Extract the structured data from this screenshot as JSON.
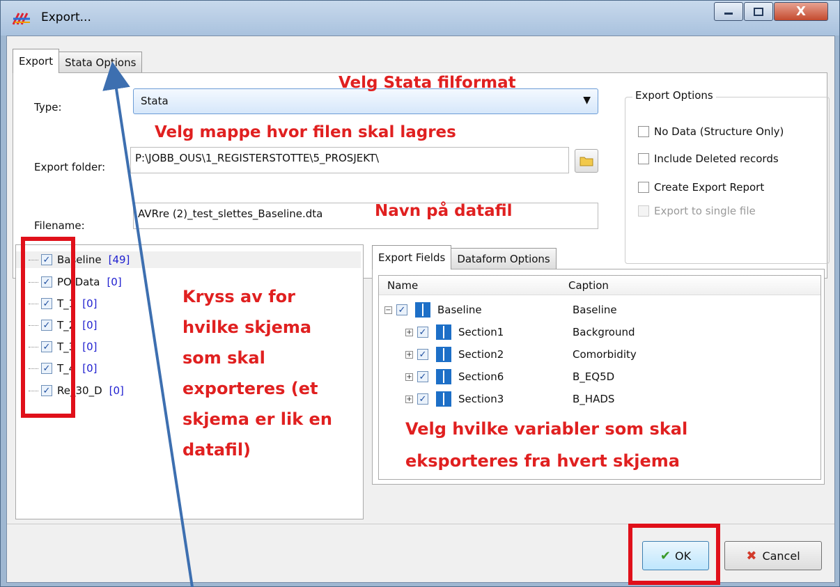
{
  "window": {
    "title": "Export...",
    "close_glyph": "X"
  },
  "tabs": {
    "export": "Export",
    "stata_options": "Stata Options"
  },
  "form": {
    "type_label": "Type:",
    "type_value": "Stata",
    "folder_label": "Export folder:",
    "folder_value": "P:\\JOBB_OUS\\1_REGISTERSTOTTE\\5_PROSJEKT\\",
    "filename_label": "Filename:",
    "filename_value": "AVRre (2)_test_slettes_Baseline.dta"
  },
  "export_options": {
    "title": "Export Options",
    "items": [
      {
        "label": "No Data (Structure Only)",
        "checked": false,
        "enabled": true
      },
      {
        "label": "Include Deleted records",
        "checked": false,
        "enabled": true
      },
      {
        "label": "Create Export Report",
        "checked": false,
        "enabled": true
      },
      {
        "label": "Export to single file",
        "checked": false,
        "enabled": false
      }
    ]
  },
  "dataforms": [
    {
      "name": "Baseline",
      "count": "[49]",
      "checked": true
    },
    {
      "name": "PO Data",
      "count": "[0]",
      "checked": true
    },
    {
      "name": "T_1",
      "count": "[0]",
      "checked": true
    },
    {
      "name": "T_2",
      "count": "[0]",
      "checked": true
    },
    {
      "name": "T_3",
      "count": "[0]",
      "checked": true
    },
    {
      "name": "T_4",
      "count": "[0]",
      "checked": true
    },
    {
      "name": "Re_30_D",
      "count": "[0]",
      "checked": true
    }
  ],
  "inner_tabs": {
    "export_fields": "Export Fields",
    "dataform_options": "Dataform Options"
  },
  "fields_grid": {
    "col_name": "Name",
    "col_caption": "Caption",
    "root": {
      "name": "Baseline",
      "caption": "Baseline",
      "checked": true,
      "expander": "−"
    },
    "children": [
      {
        "name": "Section1",
        "caption": "Background",
        "checked": true,
        "expander": "+"
      },
      {
        "name": "Section2",
        "caption": "Comorbidity",
        "checked": true,
        "expander": "+"
      },
      {
        "name": "Section6",
        "caption": "B_EQ5D",
        "checked": true,
        "expander": "+"
      },
      {
        "name": "Section3",
        "caption": "B_HADS",
        "checked": true,
        "expander": "+"
      }
    ]
  },
  "buttons": {
    "ok": "OK",
    "cancel": "Cancel"
  },
  "annotations": {
    "type": "Velg Stata filformat",
    "folder": "Velg mappe hvor filen skal lagres",
    "filename": "Navn på datafil",
    "forms_1": "Kryss av for",
    "forms_2": "hvilke skjema",
    "forms_3": "som skal",
    "forms_4": "exporteres (et",
    "forms_5": "skjema er lik en",
    "forms_6": "datafil)",
    "vars_1": "Velg hvilke variabler som skal",
    "vars_2": "eksporteres fra hvert skjema"
  },
  "colors": {
    "annotation": "#e02020",
    "arrow": "#3d6fb0",
    "count_text": "#2020d0"
  }
}
